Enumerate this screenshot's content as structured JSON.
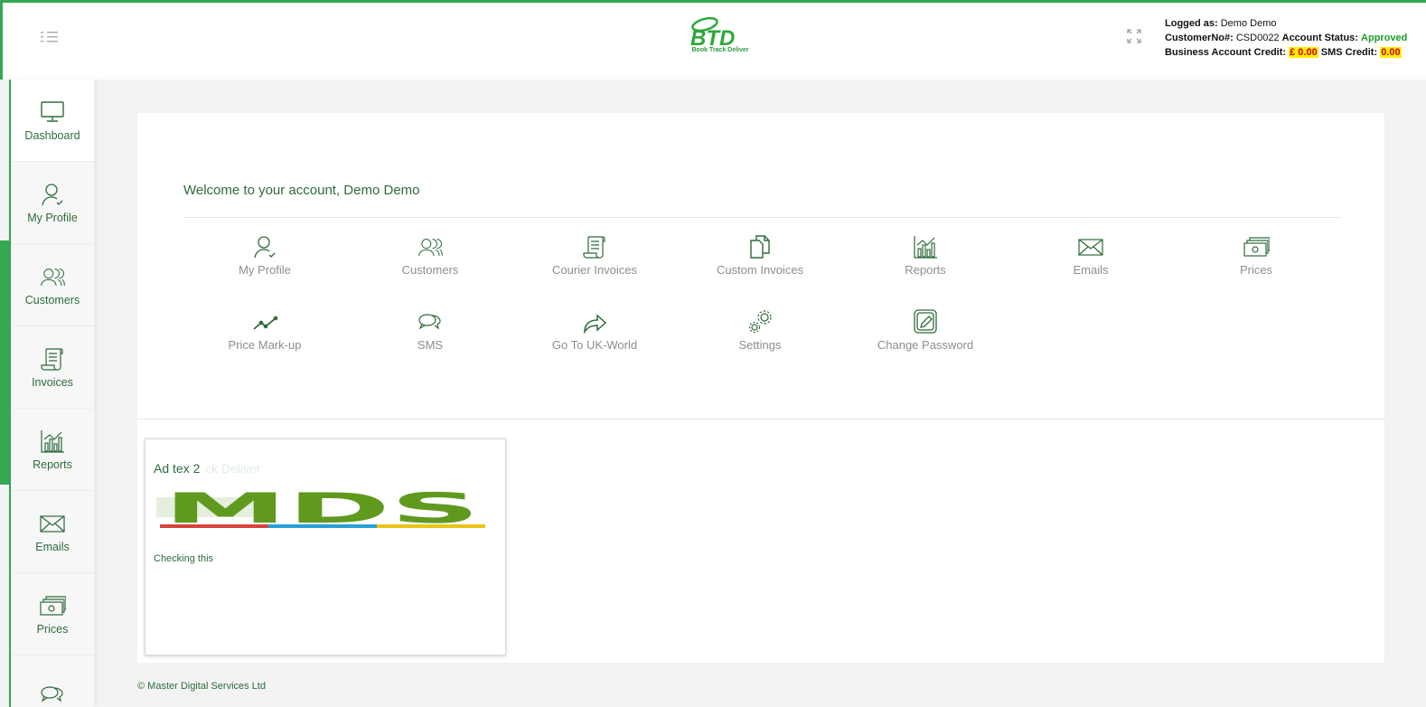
{
  "header": {
    "logo_tagline": "Book Track Deliver",
    "logged_as_label": "Logged as:",
    "logged_as_value": "Demo Demo",
    "customer_no_label": "CustomerNo#:",
    "customer_no_value": "CSD0022",
    "account_status_label": "Account Status:",
    "account_status_value": "Approved",
    "business_credit_label": "Business Account Credit:",
    "business_credit_value": "£ 0.00",
    "sms_credit_label": "SMS Credit:",
    "sms_credit_value": "0.00"
  },
  "sidebar": {
    "items": [
      {
        "label": "Dashboard",
        "icon": "monitor-icon"
      },
      {
        "label": "My Profile",
        "icon": "user-check-icon"
      },
      {
        "label": "Customers",
        "icon": "users-icon"
      },
      {
        "label": "Invoices",
        "icon": "scroll-icon"
      },
      {
        "label": "Reports",
        "icon": "bar-chart-icon"
      },
      {
        "label": "Emails",
        "icon": "envelope-icon"
      },
      {
        "label": "Prices",
        "icon": "cash-icon"
      },
      {
        "label": "",
        "icon": "chat-icon"
      }
    ]
  },
  "main": {
    "welcome": "Welcome to your account, Demo Demo",
    "tiles": [
      {
        "label": "My Profile",
        "icon": "user-check-icon"
      },
      {
        "label": "Customers",
        "icon": "users-icon"
      },
      {
        "label": "Courier Invoices",
        "icon": "scroll-icon"
      },
      {
        "label": "Custom Invoices",
        "icon": "documents-icon"
      },
      {
        "label": "Reports",
        "icon": "bar-chart-icon"
      },
      {
        "label": "Emails",
        "icon": "envelope-icon"
      },
      {
        "label": "Prices",
        "icon": "cash-icon"
      },
      {
        "label": "Price Mark-up",
        "icon": "trend-icon"
      },
      {
        "label": "SMS",
        "icon": "chat-icon"
      },
      {
        "label": "Go To UK-World",
        "icon": "share-arrow-icon"
      },
      {
        "label": "Settings",
        "icon": "gears-icon"
      },
      {
        "label": "Change Password",
        "icon": "pen-square-icon"
      }
    ]
  },
  "ad": {
    "title": "Ad tex 2",
    "ghost_text": "ck Deliver",
    "logo_text": "MDS",
    "body": "Checking this"
  },
  "footer": {
    "copyright": "© Master Digital Services Ltd"
  },
  "colors": {
    "accent_green": "#34a853",
    "text_green": "#2e6b3a",
    "highlight_yellow": "#ffee00",
    "credit_red": "#d10000"
  }
}
